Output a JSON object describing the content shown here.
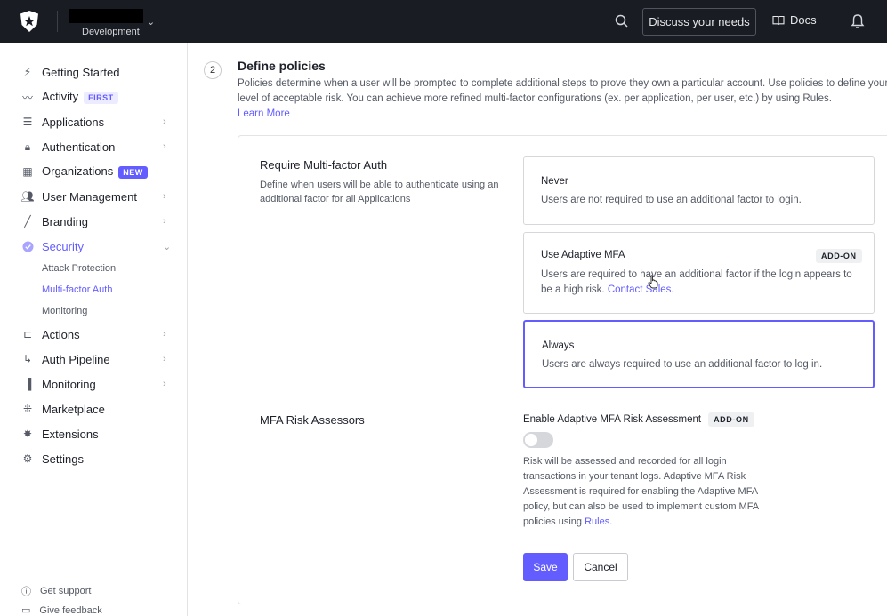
{
  "header": {
    "tenant_env": "Development",
    "chevron_icon": "chevron-down-icon",
    "discuss_label": "Discuss your needs",
    "docs_label": "Docs",
    "colors": {
      "background": "#191c23",
      "text": "#e6e7ea"
    }
  },
  "sidebar": {
    "items": [
      {
        "label": "Getting Started",
        "icon": "bolt-icon"
      },
      {
        "label": "Activity",
        "icon": "activity-icon",
        "badge": "FIRST"
      },
      {
        "label": "Applications",
        "icon": "layers-icon"
      },
      {
        "label": "Authentication",
        "icon": "lock-icon"
      },
      {
        "label": "Organizations",
        "icon": "building-icon",
        "badge": "NEW"
      },
      {
        "label": "User Management",
        "icon": "users-icon"
      },
      {
        "label": "Branding",
        "icon": "brush-icon"
      },
      {
        "label": "Security",
        "icon": "shield-icon"
      },
      {
        "label": "Actions",
        "icon": "actions-icon"
      },
      {
        "label": "Auth Pipeline",
        "icon": "pipeline-icon"
      },
      {
        "label": "Monitoring",
        "icon": "bar-chart-icon"
      },
      {
        "label": "Marketplace",
        "icon": "grid-plus-icon"
      },
      {
        "label": "Extensions",
        "icon": "puzzle-icon"
      },
      {
        "label": "Settings",
        "icon": "gear-icon"
      }
    ],
    "security_sub": [
      "Attack Protection",
      "Multi-factor Auth",
      "Monitoring"
    ],
    "footer": [
      "Get support",
      "Give feedback"
    ],
    "accent": "#635dff"
  },
  "main": {
    "step_number": "2",
    "title": "Define policies",
    "description": "Policies determine when a user will be prompted to complete additional steps to prove they own a particular account. Use policies to define your level of acceptable risk. You can achieve more refined multi-factor configurations (ex. per application, per user, etc.) by using Rules.",
    "learn_more": "Learn More",
    "require_title": "Require Multi-factor Auth",
    "require_desc": "Define when users will be able to authenticate using an additional factor for all Applications",
    "options": [
      {
        "title": "Never",
        "desc": "Users are not required to use an additional factor to login."
      },
      {
        "title": "Use Adaptive MFA",
        "badge": "ADD-ON",
        "desc": "Users are required to have an additional factor if the login appears to be a high risk.",
        "link": "Contact Sales."
      },
      {
        "title": "Always",
        "desc": "Users are always required to use an additional factor to log in.",
        "selected": true
      }
    ],
    "risk_title": "MFA Risk Assessors",
    "enable_label": "Enable Adaptive MFA Risk Assessment",
    "enable_badge": "ADD-ON",
    "toggle_on": false,
    "risk_desc": "Risk will be assessed and recorded for all login transactions in your tenant logs. Adaptive MFA Risk Assessment is required for enabling the Adaptive MFA policy, but can also be used to implement custom MFA policies using",
    "risk_link": "Rules",
    "risk_end": ".",
    "save_label": "Save",
    "cancel_label": "Cancel"
  }
}
